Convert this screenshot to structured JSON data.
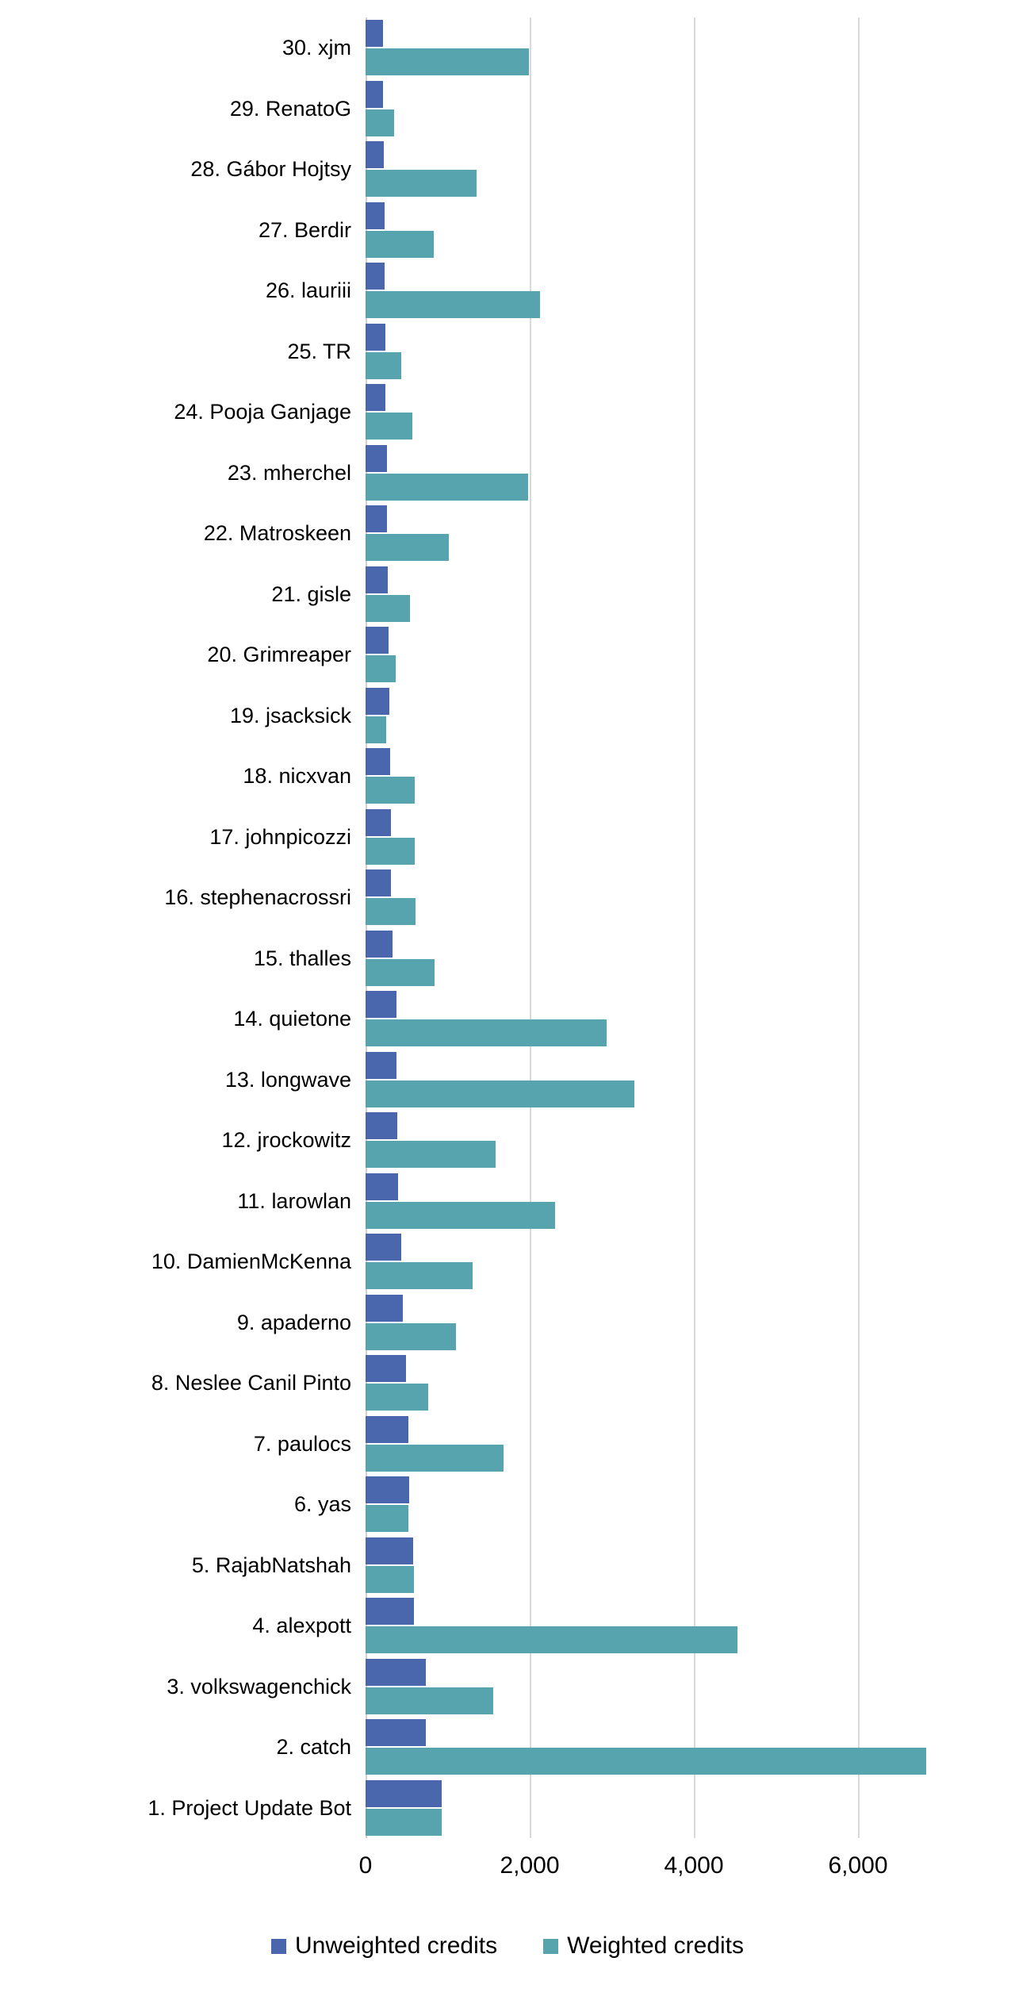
{
  "chart_data": {
    "type": "bar",
    "orientation": "horizontal",
    "title": "",
    "subtitle": "",
    "xlabel": "",
    "ylabel": "",
    "xlim": [
      0,
      7000
    ],
    "grid": true,
    "gridlines_x": [
      0,
      2000,
      4000,
      6000
    ],
    "xticks": [
      "0",
      "2,000",
      "4,000",
      "6,000"
    ],
    "legend_position": "bottom",
    "colors": {
      "unweighted": "#4a66ad",
      "weighted": "#58a4ae",
      "gridline": "#d9d9d9",
      "background": "#ffffff",
      "text": "#000000"
    },
    "categories": [
      "30. xjm",
      "29. RenatoG",
      "28. Gábor Hojtsy",
      "27. Berdir",
      "26. lauriii",
      "25. TR",
      "24. Pooja Ganjage",
      "23. mherchel",
      "22. Matroskeen",
      "21. gisle",
      "20. Grimreaper",
      "19. jsacksick",
      "18. nicxvan",
      "17. johnpicozzi",
      "16. stephenacrossri",
      "15. thalles",
      "14. quietone",
      "13. longwave",
      "12. jrockowitz",
      "11. larowlan",
      "10. DamienMcKenna",
      "9. apaderno",
      "8. Neslee Canil Pinto",
      "7. paulocs",
      "6. yas",
      "5. RajabNatshah",
      "4. alexpott",
      "3. volkswagenchick",
      "2. catch",
      "1. Project Update Bot"
    ],
    "series": [
      {
        "name": "Unweighted credits",
        "color": "#4a66ad",
        "values": [
          210,
          215,
          225,
          230,
          235,
          240,
          245,
          260,
          265,
          270,
          285,
          290,
          300,
          305,
          310,
          330,
          375,
          380,
          385,
          400,
          430,
          450,
          490,
          520,
          530,
          580,
          590,
          730,
          730,
          930
        ]
      },
      {
        "name": "Weighted credits",
        "color": "#58a4ae",
        "values": [
          1990,
          350,
          1350,
          830,
          2130,
          430,
          570,
          1980,
          1010,
          540,
          370,
          250,
          600,
          600,
          610,
          840,
          2940,
          3280,
          1580,
          2310,
          1300,
          1100,
          760,
          1680,
          520,
          590,
          4530,
          1560,
          6830,
          930
        ]
      }
    ]
  },
  "legend": {
    "items": [
      {
        "label": "Unweighted credits",
        "color": "#4a66ad"
      },
      {
        "label": "Weighted credits",
        "color": "#58a4ae"
      }
    ]
  }
}
